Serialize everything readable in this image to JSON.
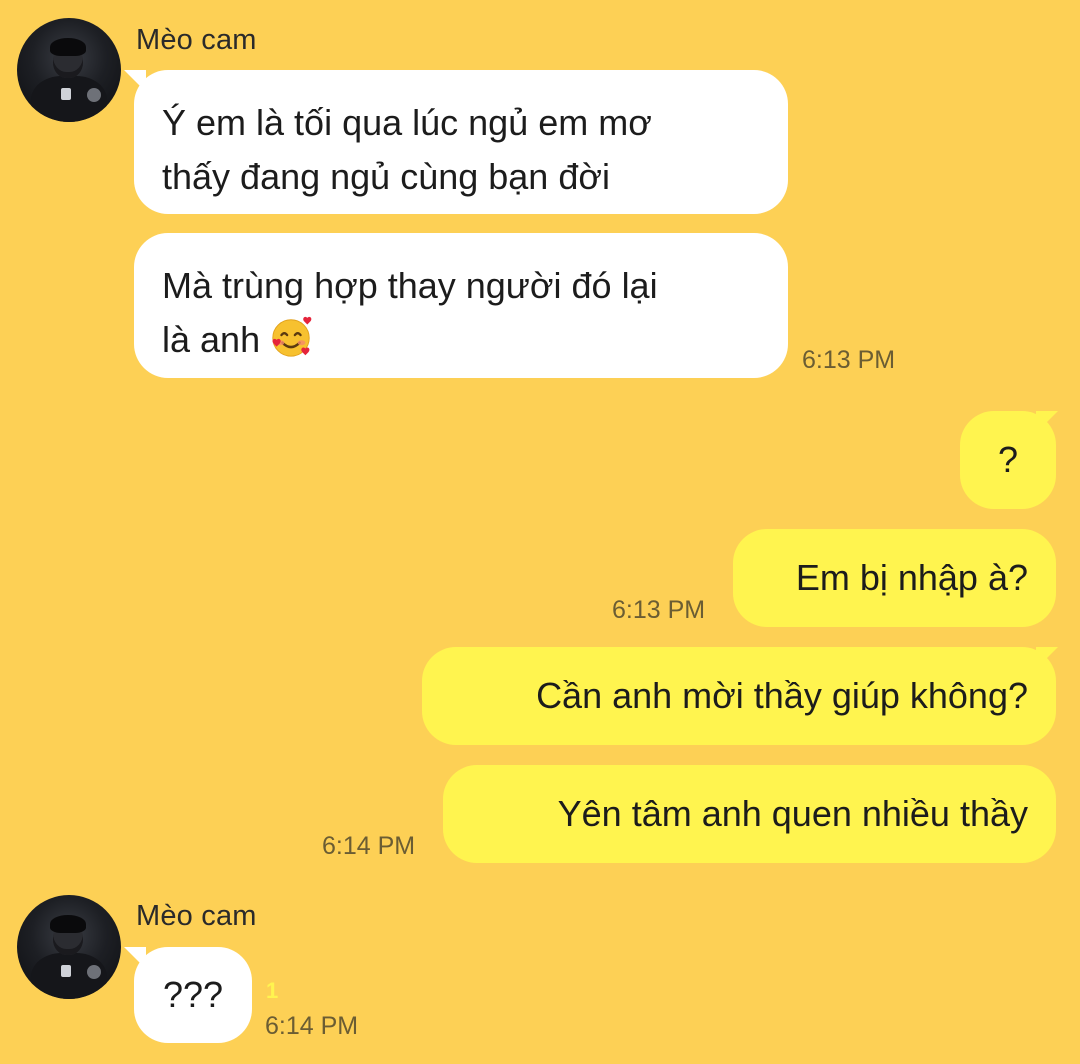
{
  "conversation": {
    "contact_name": "Mèo cam",
    "messages_group_1": {
      "sender": "Mèo cam",
      "bubble_1_line_1": "Ý em là tối qua lúc ngủ em mơ",
      "bubble_1_line_2": "thấy đang ngủ cùng bạn đời",
      "bubble_2_line_1": "Mà trùng hợp thay người đó lại",
      "bubble_2_line_2": "là anh",
      "bubble_2_emoji": "smiling-face-with-hearts-icon",
      "time": "6:13 PM"
    },
    "outgoing": {
      "msg_1": "?",
      "msg_2": "Em bị nhập à?",
      "time_1": "6:13 PM",
      "msg_3": "Cần anh mời thầy giúp không?",
      "msg_4": "Yên tâm anh quen nhiều thầy",
      "time_2": "6:14 PM"
    },
    "messages_group_2": {
      "sender": "Mèo cam",
      "bubble_1": "???",
      "unread_count": "1",
      "time": "6:14 PM"
    }
  },
  "colors": {
    "background": "#FDD055",
    "incoming_bubble": "#FFFFFF",
    "outgoing_bubble": "#FFF44F"
  }
}
